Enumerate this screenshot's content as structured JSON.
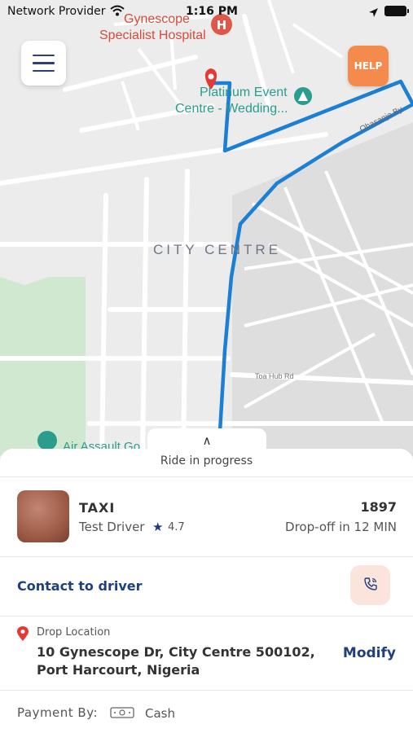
{
  "status_bar": {
    "carrier": "Network Provider",
    "time": "1:16 PM"
  },
  "map": {
    "poi_hospital_line1": "Gynescope",
    "poi_hospital_line2": "Specialist Hospital",
    "poi_event_line1": "Platinum Event",
    "poi_event_line2": "Centre - Wedding...",
    "area_label": "CITY CENTRE",
    "street_toa": "Toa Hub Rd",
    "street_obasanjo": "Obasanjo By",
    "poi_airassault": "Air Assault Go",
    "route_color": "#1b7fd4",
    "park_color": "#cfe8cf"
  },
  "help_button": {
    "label": "HELP",
    "color": "#f58a4d"
  },
  "ride": {
    "status": "Ride in progress",
    "vehicle_type": "TAXI",
    "driver_name": "Test Driver",
    "rating": "4.7",
    "trip_code": "1897",
    "dropoff_eta": "Drop-off in 12 MIN"
  },
  "contact": {
    "label": "Contact to driver"
  },
  "drop_location": {
    "label": "Drop Location",
    "address_line1": "10 Gynescope Dr, City Centre 500102,",
    "address_line2": "Port Harcourt, Nigeria",
    "modify_label": "Modify"
  },
  "payment": {
    "label": "Payment By:",
    "method": "Cash"
  },
  "icons": {
    "menu": "hamburger-menu-icon",
    "star": "star-icon",
    "phone": "phone-icon",
    "pin": "map-pin-icon",
    "cash": "cash-icon"
  },
  "accent_color": "#1f3f7f"
}
